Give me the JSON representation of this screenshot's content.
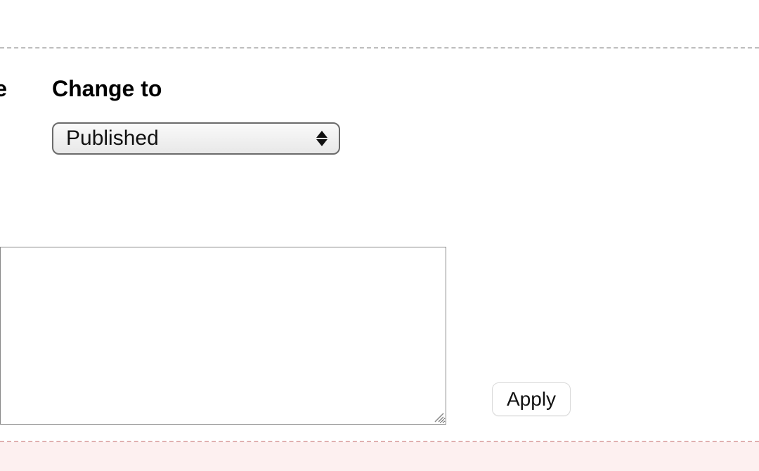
{
  "partial_left_label_fragment": "e",
  "change_to": {
    "label": "Change to",
    "selected": "Published"
  },
  "textarea": {
    "value": ""
  },
  "apply": {
    "label": "Apply"
  }
}
